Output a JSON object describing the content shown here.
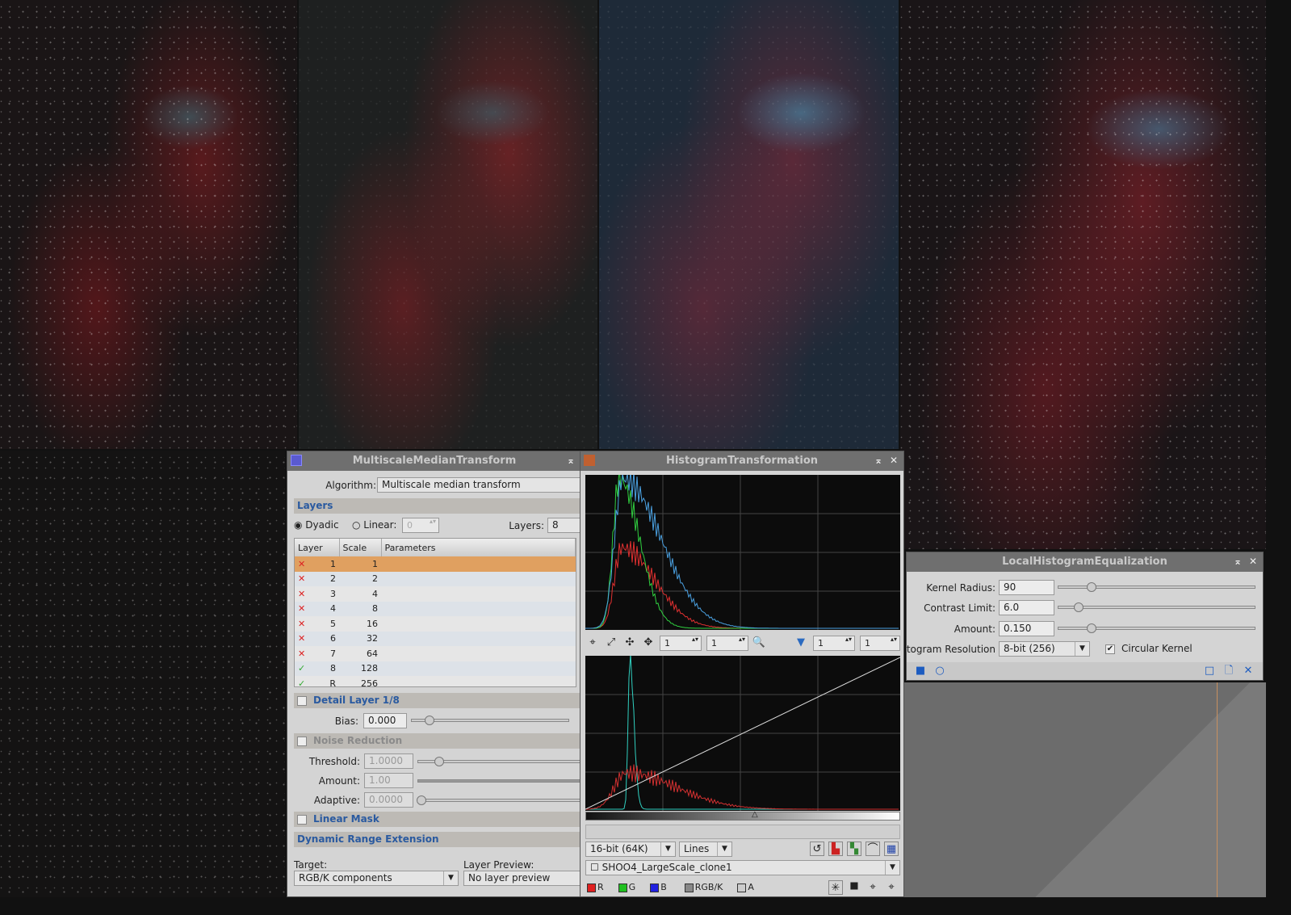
{
  "mmt": {
    "title": "MultiscaleMedianTransform",
    "algorithm_label": "Algorithm:",
    "algorithm": "Multiscale median transform",
    "layers_section": "Layers",
    "dyadic": "Dyadic",
    "linear": "Linear:",
    "linear_value": "0",
    "layers_label": "Layers:",
    "layers_value": "8",
    "columns": [
      "Layer",
      "Scale",
      "Parameters"
    ],
    "rows": [
      {
        "enabled": false,
        "layer": "1",
        "scale": "1"
      },
      {
        "enabled": false,
        "layer": "2",
        "scale": "2"
      },
      {
        "enabled": false,
        "layer": "3",
        "scale": "4"
      },
      {
        "enabled": false,
        "layer": "4",
        "scale": "8"
      },
      {
        "enabled": false,
        "layer": "5",
        "scale": "16"
      },
      {
        "enabled": false,
        "layer": "6",
        "scale": "32"
      },
      {
        "enabled": false,
        "layer": "7",
        "scale": "64"
      },
      {
        "enabled": true,
        "layer": "8",
        "scale": "128"
      },
      {
        "enabled": true,
        "layer": "R",
        "scale": "256"
      }
    ],
    "detail_section": "Detail Layer 1/8",
    "bias_label": "Bias:",
    "bias": "0.000",
    "noise_section": "Noise Reduction",
    "threshold_label": "Threshold:",
    "threshold": "1.0000",
    "amount_label": "Amount:",
    "amount": "1.00",
    "adaptive_label": "Adaptive:",
    "adaptive": "0.0000",
    "linear_mask_section": "Linear Mask",
    "dre_section": "Dynamic Range Extension",
    "target_label": "Target:",
    "target": "RGB/K components",
    "layer_preview_label": "Layer Preview:",
    "layer_preview": "No layer preview"
  },
  "ht": {
    "title": "HistogramTransformation",
    "zoom_h": "1",
    "zoom_v": "1",
    "zoom_h2": "1",
    "zoom_v2": "1",
    "resolution": "16-bit (64K)",
    "graph_style": "Lines",
    "view": "SHOO4_LargeScale_clone1",
    "channels": [
      {
        "label": "R",
        "color": "#e02020"
      },
      {
        "label": "G",
        "color": "#20c020"
      },
      {
        "label": "B",
        "color": "#2020e0"
      },
      {
        "label": "RGB/K",
        "color": "#888888"
      },
      {
        "label": "A",
        "color": "#cccccc"
      }
    ]
  },
  "lhe": {
    "title": "LocalHistogramEqualization",
    "kernel_radius_label": "Kernel Radius:",
    "kernel_radius": "90",
    "contrast_limit_label": "Contrast Limit:",
    "contrast_limit": "6.0",
    "amount_label": "Amount:",
    "amount": "0.150",
    "hist_res_label": "istogram Resolution:",
    "hist_res": "8-bit (256)",
    "circular_kernel": "Circular Kernel",
    "circular_kernel_checked": true
  }
}
